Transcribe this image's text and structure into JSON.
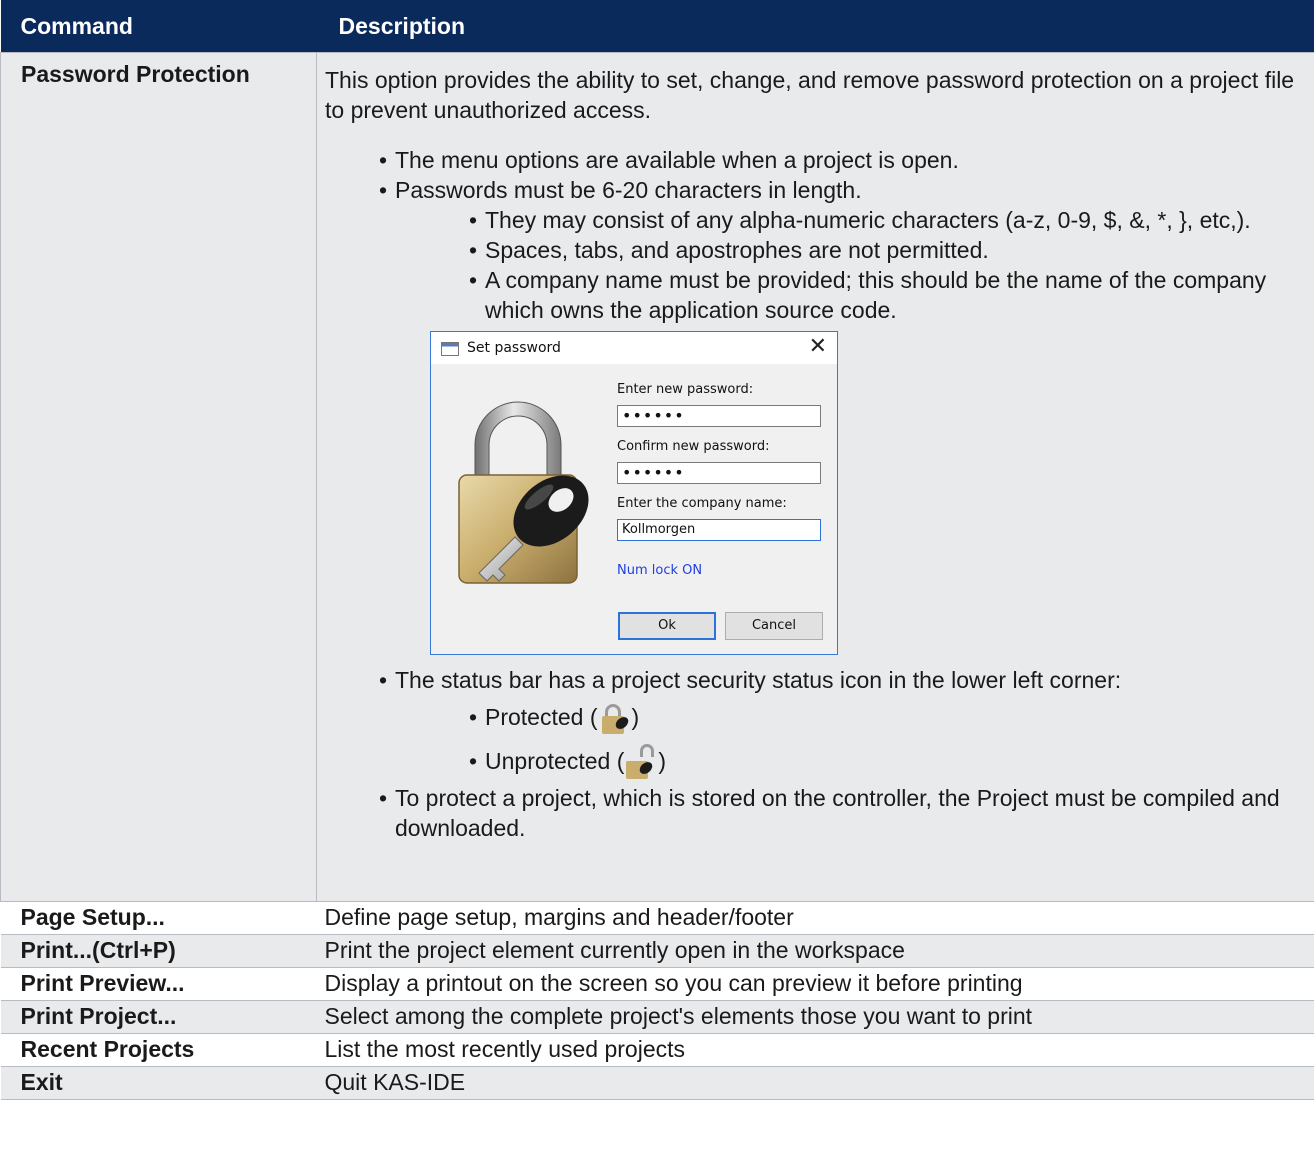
{
  "header": {
    "command": "Command",
    "description": "Description"
  },
  "password": {
    "command": "Password Protection",
    "intro": "This option provides the ability to set, change, and remove password protection on a project file to prevent unauthorized access.",
    "b1": "The menu options are available when a project is open.",
    "b2": "Passwords must be 6-20 characters in length.",
    "b2a": "They may consist of any alpha-numeric characters (a-z, 0-9, $, &, *, }, etc,).",
    "b2b": "Spaces, tabs, and apostrophes are not permitted.",
    "b2c": "A company name must be provided; this should be the name of the company which owns the application source code.",
    "b3": "The status bar has a project security status icon in the lower left corner:",
    "protected_label": "Protected (",
    "unprotected_label": "Unprotected (",
    "close_paren": ")",
    "b4": "To protect a project, which is stored on the controller, the Project must be compiled and downloaded."
  },
  "dialog": {
    "title": "Set password",
    "close": "✕",
    "enter_label": "Enter new password:",
    "enter_value": "••••••",
    "confirm_label": "Confirm new password:",
    "confirm_value": "••••••",
    "company_label": "Enter the company name:",
    "company_value": "Kollmorgen",
    "numlock": "Num lock ON",
    "ok": "Ok",
    "cancel": "Cancel"
  },
  "rows": [
    {
      "command": "Page Setup...",
      "description": "Define page setup, margins and header/footer"
    },
    {
      "command": "Print...(Ctrl+P)",
      "description": "Print the project element currently open in the workspace"
    },
    {
      "command": "Print Preview...",
      "description": "Display a printout on the screen so you can preview it before printing"
    },
    {
      "command": "Print Project...",
      "description": "Select among the complete project's elements those you want to print"
    },
    {
      "command": "Recent Projects",
      "description": "List the most recently used projects"
    },
    {
      "command": "Exit",
      "description": "Quit KAS-IDE"
    }
  ],
  "colors": {
    "header_bg": "#0a2a5c",
    "row_shade": "#e9eaec",
    "dialog_border": "#3a78d6",
    "numlock": "#1f3fe0"
  }
}
